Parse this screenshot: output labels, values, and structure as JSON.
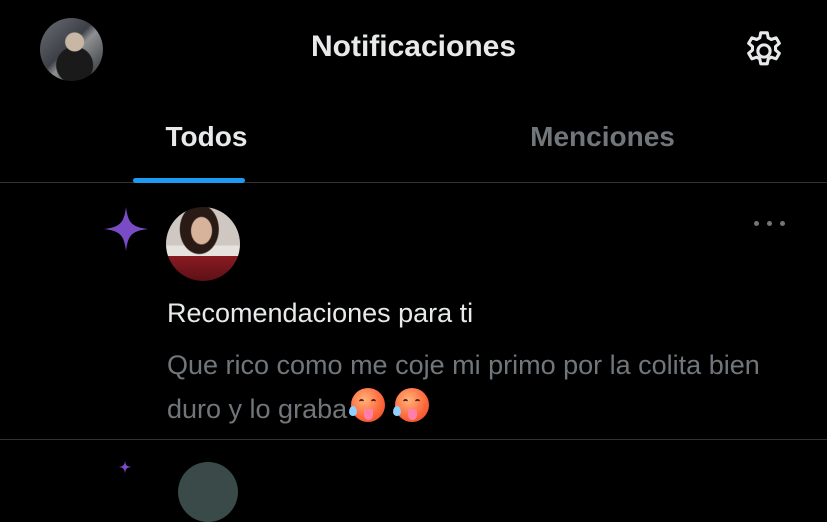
{
  "header": {
    "title": "Notificaciones",
    "settings_icon": "gear-icon",
    "avatar_icon": "profile-avatar"
  },
  "tabs": [
    {
      "label": "Todos",
      "active": true
    },
    {
      "label": "Menciones",
      "active": false
    }
  ],
  "notification": {
    "type_icon": "sparkle-icon",
    "title": "Recomendaciones para ti",
    "body": "Que rico como me coje mi primo por la colita bien duro y lo graba",
    "emojis": [
      "drooling-hot-face-emoji",
      "drooling-hot-face-emoji"
    ],
    "more_icon": "more-options-icon"
  },
  "colors": {
    "background": "#000000",
    "text_primary": "#e7e9ea",
    "text_secondary": "#71767b",
    "accent": "#1d9bf0",
    "sparkle": "#794bc4",
    "divider": "#2f3336"
  }
}
